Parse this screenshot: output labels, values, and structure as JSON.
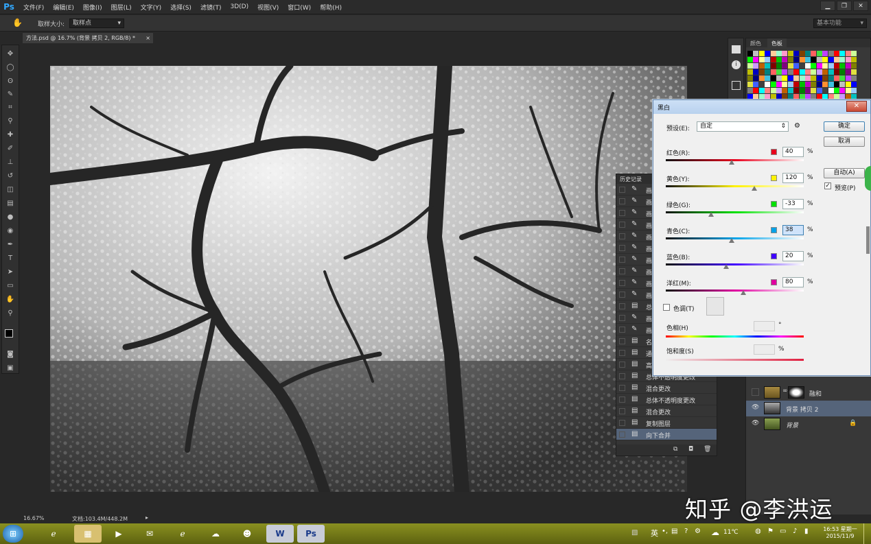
{
  "app": {
    "logo": "Ps",
    "menu": [
      "文件(F)",
      "编辑(E)",
      "图像(I)",
      "图层(L)",
      "文字(Y)",
      "选择(S)",
      "滤镜(T)",
      "3D(D)",
      "视图(V)",
      "窗口(W)",
      "帮助(H)"
    ],
    "window_controls": [
      "▁",
      "❐",
      "✕"
    ]
  },
  "options_bar": {
    "sample_size_label": "取样大小:",
    "sample_size_value": "取样点",
    "workspace": "基本功能"
  },
  "document": {
    "tab_title": "方法.psd @ 16.7% (背景 拷贝 2, RGB/8) *",
    "tab_close": "×"
  },
  "status": {
    "zoom": "16.67%",
    "doc_info": "文档:103.4M/448.2M"
  },
  "swatches_panel": {
    "tabs": [
      "颜色",
      "色板"
    ],
    "colors": [
      "#000000",
      "#404040",
      "#7f7f7f",
      "#bfbfbf",
      "#ffffff",
      "#ff0000",
      "#ffff00",
      "#00ff00",
      "#00ffff",
      "#0000ff",
      "#ff00ff",
      "#ff8080",
      "#ffcc99",
      "#ffff99",
      "#ccff99",
      "#99ffcc",
      "#99ccff",
      "#cc99ff",
      "#ff99cc",
      "#c00000",
      "#c06000",
      "#c0c000",
      "#00c000",
      "#00c0c0",
      "#0000c0",
      "#c000c0",
      "#800000",
      "#804000",
      "#808000",
      "#008000",
      "#008080",
      "#000080",
      "#800080",
      "#ff6060",
      "#ff9030",
      "#e0e040",
      "#40e040",
      "#40c0e0",
      "#4060ff",
      "#c040ff"
    ]
  },
  "history_panel": {
    "title": "历史记录",
    "items": [
      {
        "icon": "brush",
        "label": "画"
      },
      {
        "icon": "brush",
        "label": "画"
      },
      {
        "icon": "brush",
        "label": "画"
      },
      {
        "icon": "brush",
        "label": "画"
      },
      {
        "icon": "brush",
        "label": "画"
      },
      {
        "icon": "brush",
        "label": "画"
      },
      {
        "icon": "brush",
        "label": "画"
      },
      {
        "icon": "brush",
        "label": "画"
      },
      {
        "icon": "brush",
        "label": "画"
      },
      {
        "icon": "brush",
        "label": "画"
      },
      {
        "icon": "doc",
        "label": "总"
      },
      {
        "icon": "brush",
        "label": "画"
      },
      {
        "icon": "brush",
        "label": "画"
      },
      {
        "icon": "doc",
        "label": "名"
      },
      {
        "icon": "doc",
        "label": "通"
      },
      {
        "icon": "doc",
        "label": "高"
      },
      {
        "icon": "doc",
        "label": "总体不透明度更改"
      },
      {
        "icon": "doc",
        "label": "混合更改"
      },
      {
        "icon": "doc",
        "label": "总体不透明度更改"
      },
      {
        "icon": "doc",
        "label": "混合更改"
      },
      {
        "icon": "doc",
        "label": "复制图层"
      },
      {
        "icon": "doc",
        "label": "向下合并"
      }
    ]
  },
  "layers_panel": {
    "layers": [
      {
        "name": "融和",
        "visible": false,
        "locked": false
      },
      {
        "name": "背景 拷贝 2",
        "visible": true,
        "locked": false
      },
      {
        "name": "背景",
        "visible": true,
        "locked": true
      }
    ]
  },
  "bw_dialog": {
    "title": "黑白",
    "preset_label": "预设(E):",
    "preset_value": "自定",
    "ok": "确定",
    "cancel": "取消",
    "auto": "自动(A)",
    "preview_label": "预览(P)",
    "preview_checked": true,
    "percent": "%",
    "sliders": [
      {
        "label": "红色(R):",
        "value": "40",
        "color": "#e8001c",
        "pos": 0.48
      },
      {
        "label": "黄色(Y):",
        "value": "120",
        "color": "#fff200",
        "pos": 0.64
      },
      {
        "label": "绿色(G):",
        "value": "-33",
        "color": "#00e000",
        "pos": 0.33
      },
      {
        "label": "青色(C):",
        "value": "38",
        "color": "#00a2e8",
        "pos": 0.48
      },
      {
        "label": "蓝色(B):",
        "value": "20",
        "color": "#3f00ff",
        "pos": 0.44
      },
      {
        "label": "洋红(M):",
        "value": "80",
        "color": "#e000a0",
        "pos": 0.56
      }
    ],
    "tint_label": "色调(T)",
    "tint_checked": false,
    "hue_label": "色相(H)",
    "hue_unit": "°",
    "saturation_label": "饱和度(S)",
    "saturation_unit": "%"
  },
  "watermark": "知乎 @李洪运",
  "taskbar": {
    "ime": "英",
    "temperature": "11℃",
    "time": "16:53 星期一",
    "date": "2015/11/9"
  }
}
